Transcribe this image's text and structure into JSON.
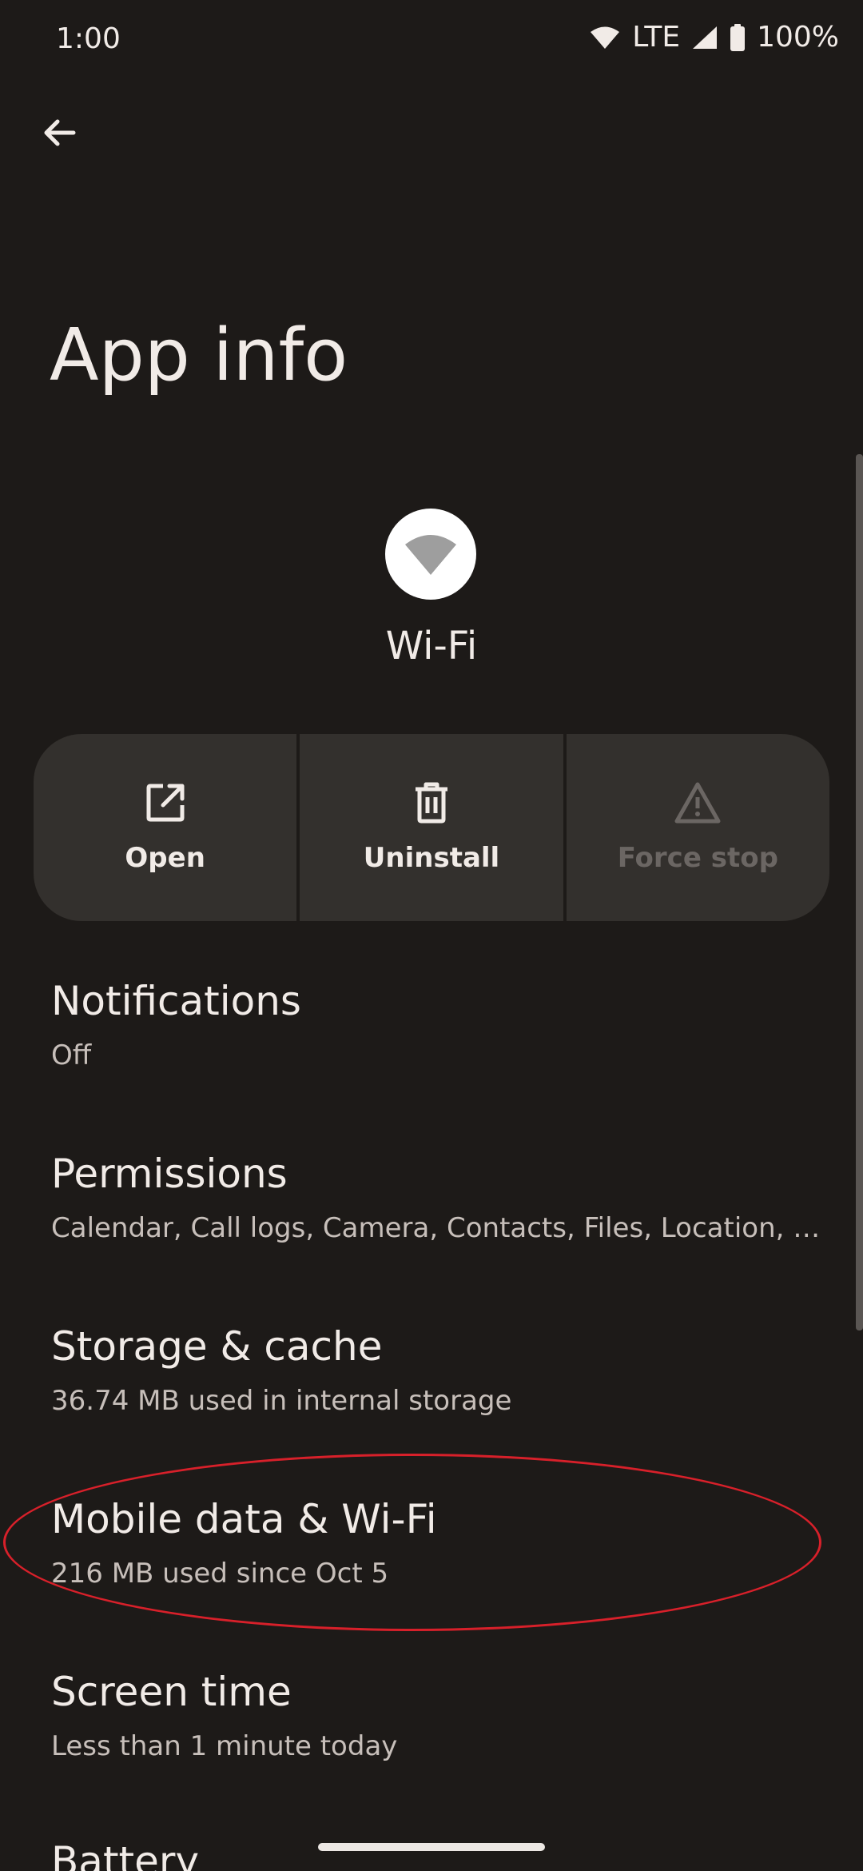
{
  "status_bar": {
    "time": "1:00",
    "network": "LTE",
    "battery": "100%"
  },
  "header": {
    "title": "App info"
  },
  "app": {
    "name": "Wi-Fi",
    "icon": "wifi-icon"
  },
  "actions": [
    {
      "label": "Open",
      "icon": "open-external-icon",
      "enabled": true
    },
    {
      "label": "Uninstall",
      "icon": "trash-icon",
      "enabled": true
    },
    {
      "label": "Force stop",
      "icon": "warning-icon",
      "enabled": false
    }
  ],
  "list": {
    "notifications": {
      "title": "Notifications",
      "summary": "Off"
    },
    "permissions": {
      "title": "Permissions",
      "summary": "Calendar, Call logs, Camera, Contacts, Files, Location, Mi..."
    },
    "storage": {
      "title": "Storage & cache",
      "summary": "36.74 MB used in internal storage"
    },
    "mobile_data": {
      "title": "Mobile data & Wi-Fi",
      "summary": "216 MB used since Oct 5"
    },
    "screen_time": {
      "title": "Screen time",
      "summary": "Less than 1 minute today"
    },
    "battery": {
      "title": "Battery"
    }
  },
  "colors": {
    "background": "#1d1a18",
    "button_bg": "#33302d",
    "annotation": "#d8202a"
  }
}
